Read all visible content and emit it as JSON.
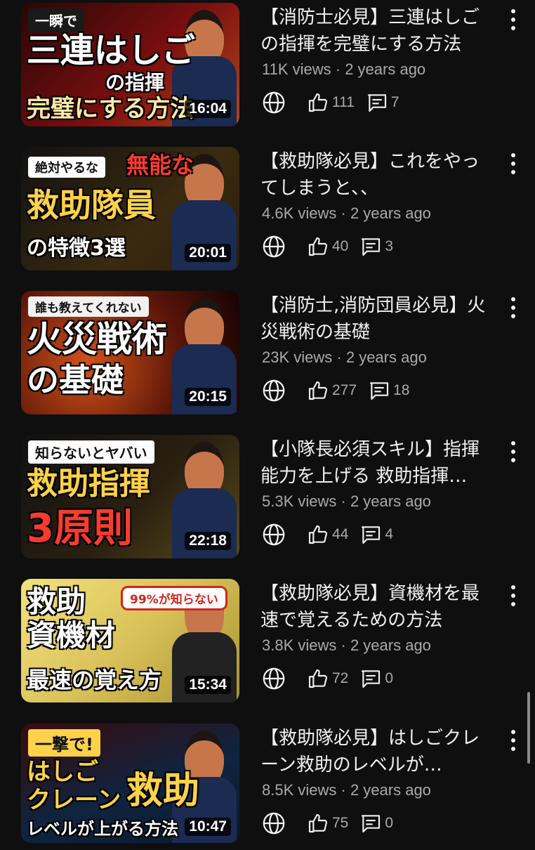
{
  "videos": [
    {
      "title": "【消防士必見】三連はしごの指揮を完璧にする方法",
      "views": "11K views",
      "age": "2 years ago",
      "likes": "111",
      "comments": "7",
      "duration": "16:04",
      "thumb_lines": [
        "一瞬で",
        "三連はしご",
        "の指揮",
        "完璧にする方法"
      ],
      "theme_color": "#7a0f0f"
    },
    {
      "title": "【救助隊必見】これをやってしまうと、、",
      "views": "4.6K views",
      "age": "2 years ago",
      "likes": "40",
      "comments": "3",
      "duration": "20:01",
      "thumb_lines": [
        "絶対やるな",
        "無能な",
        "救助隊員",
        "の特徴3選"
      ],
      "theme_color": "#3a2a10"
    },
    {
      "title": "【消防士,消防団員必見】火災戦術の基礎",
      "views": "23K views",
      "age": "2 years ago",
      "likes": "277",
      "comments": "18",
      "duration": "20:15",
      "thumb_lines": [
        "誰も教えてくれない",
        "火災戦術",
        "の基礎"
      ],
      "theme_color": "#5a1508"
    },
    {
      "title": "【小隊長必須スキル】指揮能力を上げる 救助指揮…",
      "views": "5.3K views",
      "age": "2 years ago",
      "likes": "44",
      "comments": "4",
      "duration": "22:18",
      "thumb_lines": [
        "知らないとヤバい",
        "救助指揮",
        "3原則"
      ],
      "theme_color": "#2a2010"
    },
    {
      "title": "【救助隊必見】資機材を最速で覚えるための方法",
      "views": "3.8K views",
      "age": "2 years ago",
      "likes": "72",
      "comments": "0",
      "duration": "15:34",
      "thumb_lines": [
        "救助",
        "資機材",
        "99%が知らない",
        "最速の覚え方"
      ],
      "theme_color": "#d9c15a"
    },
    {
      "title": "【救助隊必見】はしごクレーン救助のレベルが…",
      "views": "8.5K views",
      "age": "2 years ago",
      "likes": "75",
      "comments": "0",
      "duration": "10:47",
      "thumb_lines": [
        "一撃で!",
        "はしご",
        "クレーン",
        "救助",
        "レベルが上がる方法"
      ],
      "theme_color": "#0f2440"
    }
  ],
  "icons": {
    "visibility": "globe-icon",
    "likes": "thumbs-up-icon",
    "comments": "comment-icon",
    "menu": "more-vert-icon"
  },
  "colors": {
    "background": "#0f0f0f",
    "text_primary": "#f1f1f1",
    "text_secondary": "#aaaaaa"
  }
}
